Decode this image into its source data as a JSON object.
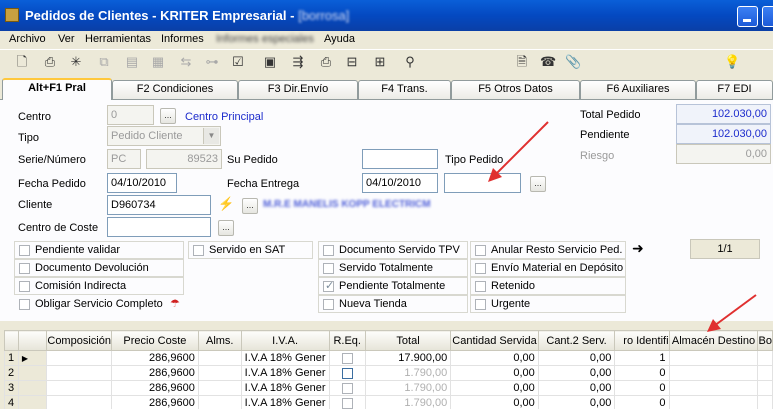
{
  "window": {
    "title": "Pedidos de Clientes - KRITER Empresarial - ",
    "title_blurred": "[borrosa]"
  },
  "menu": [
    "Archivo",
    "Ver",
    "Herramientas",
    "Informes",
    "Informes especiales",
    "Ayuda"
  ],
  "toolbar_icons": [
    "new-doc-icon",
    "print-icon",
    "crosshair-icon",
    "copy-icon",
    "doc-icon",
    "split-icon",
    "tree-icon",
    "checklist-icon",
    "calculator-icon",
    "network-icon",
    "printer-icon",
    "diagram-icon",
    "pin-icon",
    "notepad-icon",
    "phone-icon",
    "paperclip-icon",
    "bulb-icon"
  ],
  "tabs": [
    "Alt+F1 Pral",
    "F2 Condiciones",
    "F3 Dir.Envío",
    "F4 Trans.",
    "F5 Otros Datos",
    "F6 Auxiliares",
    "F7 EDI"
  ],
  "form": {
    "centro_label": "Centro",
    "centro_value": "0",
    "centro_name": "Centro Principal",
    "tipo_label": "Tipo",
    "tipo_value": "Pedido Cliente",
    "serie_label": "Serie/Número",
    "serie_value": "PC",
    "numero_value": "89523",
    "su_pedido_label": "Su Pedido",
    "su_pedido_value": "",
    "tipo_pedido_label": "Tipo Pedido",
    "tipo_pedido_value": "",
    "fecha_pedido_label": "Fecha Pedido",
    "fecha_pedido_value": "04/10/2010",
    "fecha_entrega_label": "Fecha Entrega",
    "fecha_entrega_value": "04/10/2010",
    "cliente_label": "Cliente",
    "cliente_value": "D960734",
    "cliente_name_blurred": "M.R.E MANELIS KOPP ELECTRICM",
    "centro_coste_label": "Centro de Coste",
    "centro_coste_value": ""
  },
  "totals": {
    "total_label": "Total Pedido",
    "total_value": "102.030,00",
    "pendiente_label": "Pendiente",
    "pendiente_value": "102.030,00",
    "riesgo_label": "Riesgo",
    "riesgo_value": "0,00"
  },
  "checkboxes": {
    "pendiente_validar": "Pendiente validar",
    "documento_devolucion": "Documento Devolución",
    "comision_indirecta": "Comisión Indirecta",
    "obligar_servicio": "Obligar Servicio Completo",
    "servido_sat": "Servido en SAT",
    "documento_tpv": "Documento Servido TPV",
    "servido_totalmente": "Servido Totalmente",
    "pendiente_totalmente": "Pendiente Totalmente",
    "nueva_tienda": "Nueva Tienda",
    "anular_resto": "Anular Resto Servicio Ped.",
    "envio_material": "Envío Material en Depósito",
    "retenido": "Retenido",
    "urgente": "Urgente"
  },
  "pager": "1/1",
  "grid": {
    "columns": [
      "Composición",
      "Precio Coste",
      "Alms.",
      "I.V.A.",
      "R.Eq.",
      "Total",
      "Cantidad Servida",
      "Cant.2 Serv.",
      "ro Identifi",
      "Almacén Destino",
      "Bo"
    ],
    "rows": [
      {
        "n": "1",
        "coste": "286,9600",
        "iva": "I.V.A 18% Gener",
        "total": "17.900,00",
        "serv": "0,00",
        "serv2": "0,00",
        "ident": "1"
      },
      {
        "n": "2",
        "coste": "286,9600",
        "iva": "I.V.A 18% Gener",
        "total": "1.790,00",
        "serv": "0,00",
        "serv2": "0,00",
        "ident": "0"
      },
      {
        "n": "3",
        "coste": "286,9600",
        "iva": "I.V.A 18% Gener",
        "total": "1.790,00",
        "serv": "0,00",
        "serv2": "0,00",
        "ident": "0"
      },
      {
        "n": "4",
        "coste": "286,9600",
        "iva": "I.V.A 18% Gener",
        "total": "1.790,00",
        "serv": "0,00",
        "serv2": "0,00",
        "ident": "0"
      }
    ]
  },
  "colors": {
    "titlebar": "#0449c1",
    "link_blue": "#1c2bcc",
    "annotation_arrow": "#e03030"
  }
}
